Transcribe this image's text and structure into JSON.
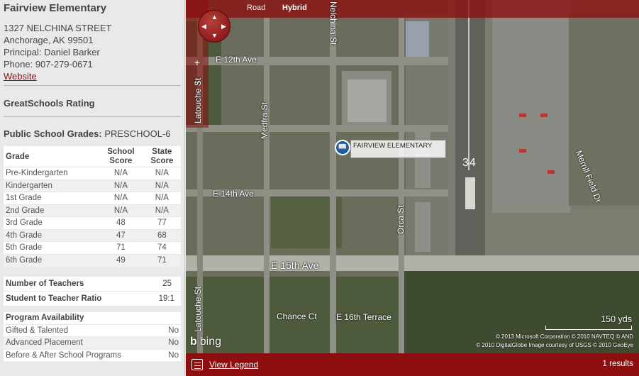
{
  "school": {
    "name": "Fairview Elementary",
    "address_line1": "1327 NELCHINA STREET",
    "address_line2": "Anchorage, AK 99501",
    "principal": "Principal: Daniel Barker",
    "phone": "Phone: 907-279-0671",
    "website_label": "Website"
  },
  "rating": {
    "heading": "GreatSchools Rating"
  },
  "grades_offered": {
    "label": "Public School Grades:",
    "value": "PRESCHOOL-6"
  },
  "score_table": {
    "headers": {
      "grade": "Grade",
      "school_line1": "School",
      "school_line2": "Score",
      "state_line1": "State",
      "state_line2": "Score"
    },
    "rows": [
      {
        "grade": "Pre-Kindergarten",
        "school": "N/A",
        "state": "N/A"
      },
      {
        "grade": "Kindergarten",
        "school": "N/A",
        "state": "N/A"
      },
      {
        "grade": "1st Grade",
        "school": "N/A",
        "state": "N/A"
      },
      {
        "grade": "2nd Grade",
        "school": "N/A",
        "state": "N/A"
      },
      {
        "grade": "3rd Grade",
        "school": "48",
        "state": "77"
      },
      {
        "grade": "4th Grade",
        "school": "47",
        "state": "68"
      },
      {
        "grade": "5th Grade",
        "school": "71",
        "state": "74"
      },
      {
        "grade": "6th Grade",
        "school": "49",
        "state": "71"
      }
    ]
  },
  "staff": {
    "teachers_label": "Number of Teachers",
    "teachers_value": "25",
    "ratio_label": "Student to Teacher Ratio",
    "ratio_value": "19:1"
  },
  "programs": {
    "heading": "Program Availability",
    "rows": [
      {
        "name": "Gifted & Talented",
        "value": "No"
      },
      {
        "name": "Advanced Placement",
        "value": "No"
      },
      {
        "name": "Before & After School Programs",
        "value": "No"
      }
    ]
  },
  "map": {
    "tabs": {
      "road": "Road",
      "hybrid": "Hybrid"
    },
    "active_tab": "Hybrid",
    "zoom_in": "+",
    "zoom_out": "−",
    "pin_label": "FAIRVIEW ELEMENTARY",
    "streets": {
      "e12": "E 12th Ave",
      "e14": "E 14th Ave",
      "e15": "E 15th Ave",
      "chance": "Chance Ct",
      "e16": "E 16th Terrace",
      "nelchina": "Nelchina St",
      "medfra": "Medfra St",
      "latouche_top": "Latouche St",
      "latouche_bottom": "Latouche St",
      "orca": "Orca St",
      "merrill": "Merrill Field Dr"
    },
    "runway_number": "34",
    "scale": "150 yds",
    "copyright_line1": "© 2013 Microsoft Corporation   © 2010 NAVTEQ   © AND",
    "copyright_line2": "© 2010 DigitalGlobe   Image courtesy of USGS   © 2010 GeoEye",
    "provider": "bing"
  },
  "bottom_bar": {
    "legend_label": "View Legend",
    "results": "1 results"
  },
  "colors": {
    "accent": "#8c0e0e",
    "link": "#8a1010",
    "pin": "#1b5fa8"
  }
}
